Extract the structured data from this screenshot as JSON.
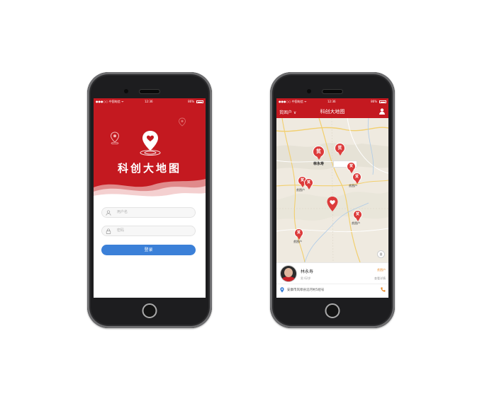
{
  "status_bar": {
    "carrier": "●●●○○ 中国电信 ᯤ",
    "time": "12:36",
    "battery": "86%"
  },
  "login": {
    "app_title": "科创大地图",
    "username_placeholder": "用户名",
    "password_placeholder": "密码",
    "login_button": "登录"
  },
  "map_screen": {
    "nav_left": "贫困户 ∨",
    "title": "科创大地图",
    "pin_glyph": "贫",
    "labels": {
      "main": "林永寿",
      "village_a": "贫困户",
      "village_b": "贫困户",
      "village_c": "贫困户",
      "village_d": "贫困户"
    },
    "card": {
      "name": "林永寿",
      "sub": "男 62岁",
      "tag": "贫困户",
      "link": "查看详情",
      "address": "安康市岚皋县滔河村5组号"
    }
  },
  "colors": {
    "brand_red": "#c41920",
    "button_blue": "#3b80d8",
    "pin_red": "#dc3b3b"
  },
  "icons": [
    "location-pin-icon",
    "heart-pin-icon",
    "user-icon",
    "lock-icon",
    "locate-icon",
    "phone-icon"
  ]
}
